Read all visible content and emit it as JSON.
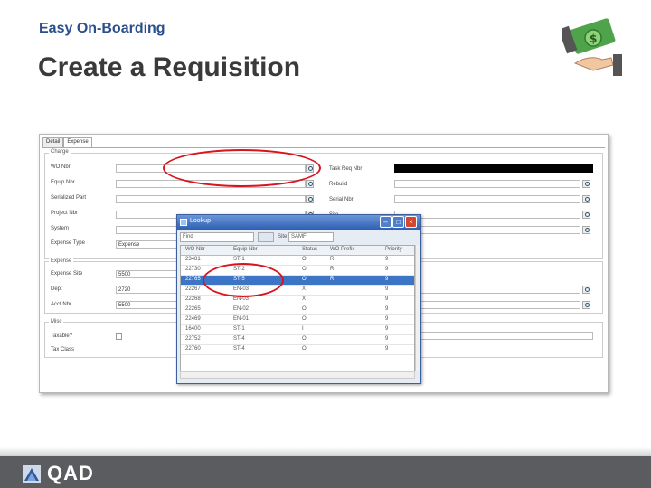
{
  "slide": {
    "subtitle": "Easy On-Boarding",
    "title": "Create a Requisition",
    "logo_text": "QAD",
    "brand_colors": {
      "subtitle": "#2b4f8c",
      "footer": "#5a5c5f",
      "highlight": "#d9141c"
    }
  },
  "app": {
    "tabs": [
      "Detail",
      "Expense"
    ],
    "active_tab": "Expense",
    "charge_group": {
      "label": "Charge",
      "rows": [
        {
          "label": "WO Nbr",
          "value": ""
        },
        {
          "label": "Equip Nbr",
          "value": ""
        },
        {
          "label": "Serialized Part",
          "value": ""
        },
        {
          "label": "Project Nbr",
          "value": ""
        },
        {
          "label": "System",
          "value": ""
        },
        {
          "label": "Expense Type",
          "value": "Expense"
        }
      ],
      "right_rows": [
        {
          "label": "Task Req Nbr",
          "value": ""
        },
        {
          "label": "Rebuild",
          "value": ""
        },
        {
          "label": "Serial Nbr",
          "value": ""
        },
        {
          "label": "Site",
          "value": ""
        }
      ]
    },
    "expense_group": {
      "label": "Expense",
      "rows": [
        {
          "label": "Expense Site",
          "value": "5500"
        },
        {
          "label": "Dept",
          "value": "2720"
        },
        {
          "label": "Acct Nbr",
          "value": "5500"
        }
      ]
    },
    "misc_group": {
      "label": "Misc",
      "rows": [
        {
          "label": "Taxable?",
          "value": ""
        },
        {
          "label": "Tax Class",
          "value": ""
        }
      ]
    }
  },
  "lookup": {
    "title": "Lookup",
    "search_field": "Find",
    "site_label": "Site",
    "site_value": "SAMF",
    "columns": [
      "WO Nbr",
      "Equip Nbr",
      "Status",
      "WO Prefix",
      "Priority"
    ],
    "rows": [
      {
        "wo": "23481",
        "equip": "ST-1",
        "status": "O",
        "prefix": "R",
        "priority": "9"
      },
      {
        "wo": "22730",
        "equip": "ST-2",
        "status": "O",
        "prefix": "R",
        "priority": "9"
      },
      {
        "wo": "22765",
        "equip": "ST-5",
        "status": "O",
        "prefix": "R",
        "priority": "9"
      },
      {
        "wo": "22267",
        "equip": "EN-03",
        "status": "X",
        "prefix": "",
        "priority": "9"
      },
      {
        "wo": "22268",
        "equip": "EN-03",
        "status": "X",
        "prefix": "",
        "priority": "9"
      },
      {
        "wo": "22265",
        "equip": "EN-02",
        "status": "O",
        "prefix": "",
        "priority": "9"
      },
      {
        "wo": "22469",
        "equip": "EN-01",
        "status": "O",
        "prefix": "",
        "priority": "9"
      },
      {
        "wo": "16400",
        "equip": "ST-1",
        "status": "I",
        "prefix": "",
        "priority": "9"
      },
      {
        "wo": "22752",
        "equip": "ST-4",
        "status": "O",
        "prefix": "",
        "priority": "9"
      },
      {
        "wo": "22760",
        "equip": "ST-4",
        "status": "O",
        "prefix": "",
        "priority": "9"
      }
    ],
    "selected_row": 2
  }
}
